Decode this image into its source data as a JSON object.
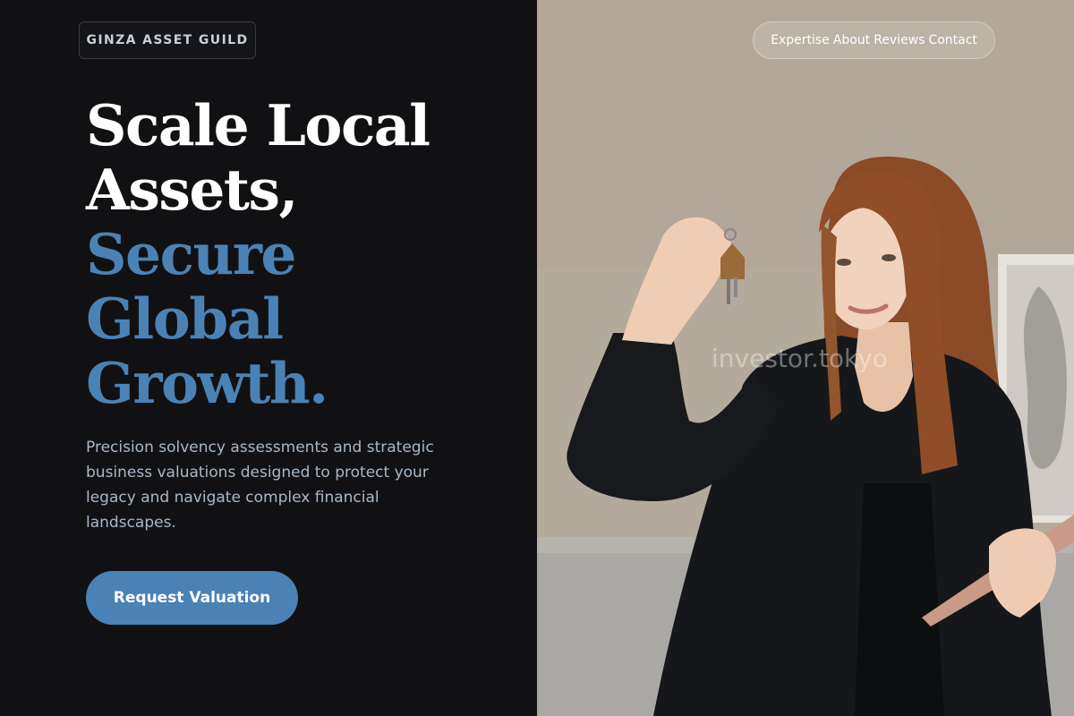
{
  "brand": {
    "name": "GINZA ASSET GUILD"
  },
  "nav": {
    "items": [
      "Expertise",
      "About",
      "Reviews",
      "Contact"
    ]
  },
  "hero": {
    "headline_lines": [
      "Scale Local",
      "Assets,"
    ],
    "accent_lines": [
      "Secure",
      "Global",
      "Growth."
    ],
    "lede": "Precision solvency assessments and strategic business valuations designed to protect your legacy and navigate complex financial landscapes.",
    "cta_label": "Request Valuation"
  },
  "photo": {
    "watermark": "investor.tokyo"
  },
  "colors": {
    "background": "#111113",
    "accent": "#4a82b6",
    "headline": "#ffffff",
    "body_text": "#aab8c8",
    "brand_text": "#c9ced8"
  }
}
